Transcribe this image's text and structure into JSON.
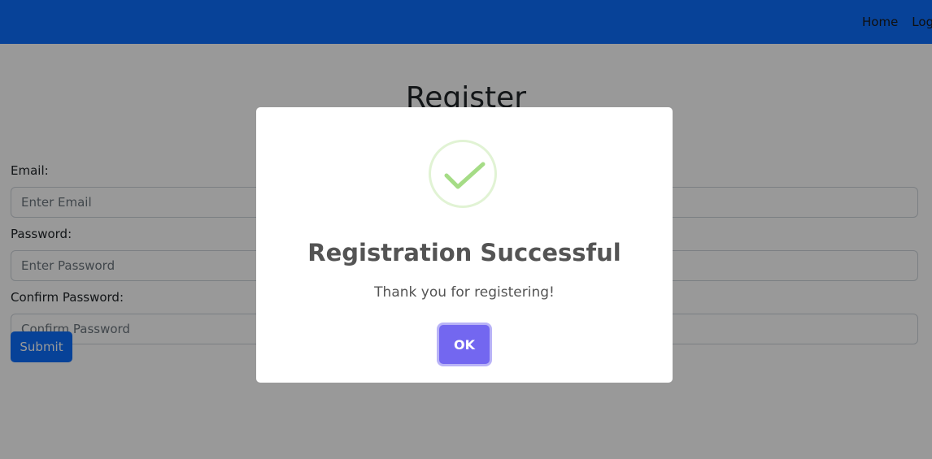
{
  "navbar": {
    "links": [
      {
        "label": "Home"
      },
      {
        "label": "Login"
      }
    ]
  },
  "main": {
    "title": "Register",
    "form": {
      "email": {
        "label": "Email:",
        "placeholder": "Enter Email"
      },
      "password": {
        "label": "Password:",
        "placeholder": "Enter Password"
      },
      "confirm": {
        "label": "Confirm Password:",
        "placeholder": "Confirm Password"
      },
      "submit_label": "Submit"
    }
  },
  "modal": {
    "icon": "success-check-icon",
    "title": "Registration Successful",
    "text": "Thank you for registering!",
    "ok_label": "OK"
  },
  "colors": {
    "navbar": "#0d6efd",
    "primary_button": "#0d6efd",
    "confirm_button": "#7367f0",
    "success_check": "#a5dc86"
  }
}
